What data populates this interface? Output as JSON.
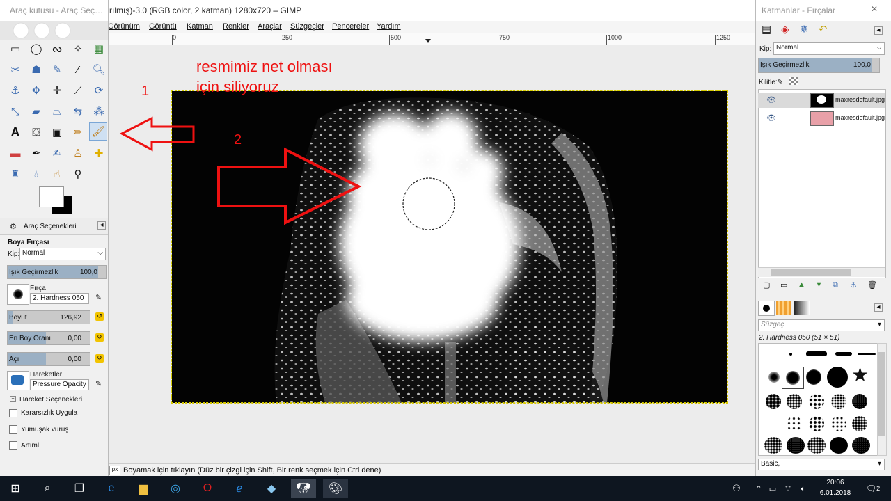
{
  "main_window": {
    "title": "rılmış)-3.0 (RGB color, 2 katman) 1280x720 – GIMP",
    "menu": [
      "Görünüm",
      "Görüntü",
      "Katman",
      "Renkler",
      "Araçlar",
      "Süzgeçler",
      "Pencereler",
      "Yardım"
    ],
    "ruler_labels": [
      "0",
      "250",
      "500",
      "750",
      "1000",
      "1250"
    ],
    "status_unit": "px",
    "status_text": "Boyamak için tıklayın (Düz bir çizgi için Shift, Bir renk seçmek için Ctrl dene)"
  },
  "annotations": {
    "caption_line1": "resmimiz net olması",
    "caption_line2": "için siliyoruz",
    "num1": "1",
    "num2": "2"
  },
  "toolbox": {
    "title": "Araç kutusu - Araç Seç…",
    "tab_label": "Araç Seçenekleri",
    "section_title": "Boya Fırçası",
    "mode_label": "Kip:",
    "mode_value": "Normal",
    "opacity_label": "Işık Geçirmezlik",
    "opacity_value": "100,0",
    "brush_label": "Fırça",
    "brush_value": "2. Hardness 050",
    "size_label": "Boyut",
    "size_value": "126,92",
    "aspect_label": "En Boy Oranı",
    "aspect_value": "0,00",
    "angle_label": "Açı",
    "angle_value": "0,00",
    "dynamics_label": "Hareketler",
    "dynamics_value": "Pressure Opacity",
    "dynamics_options": "Hareket Seçenekleri",
    "check_jitter": "Kararsızlık Uygula",
    "check_smooth": "Yumuşak vuruş",
    "check_incremental": "Artımlı"
  },
  "dock": {
    "title": "Katmanlar - Fırçalar",
    "mode_label": "Kip:",
    "mode_value": "Normal",
    "opacity_label": "Işık Geçirmezlik",
    "opacity_value": "100,0",
    "lock_label": "Kilitle:",
    "layers": [
      {
        "name": "maxresdefault.jpg"
      },
      {
        "name": "maxresdefault.jpg"
      }
    ],
    "filter_placeholder": "Süzgeç",
    "brush_name": "2. Hardness 050 (51 × 51)",
    "preset_value": "Basic,"
  },
  "taskbar": {
    "time": "20:06",
    "date": "6.01.2018",
    "notification_count": "2"
  },
  "colors": {
    "annotation_red": "#e11111",
    "selection_yellow": "#d6cf00",
    "taskbar": "#0e1620"
  }
}
